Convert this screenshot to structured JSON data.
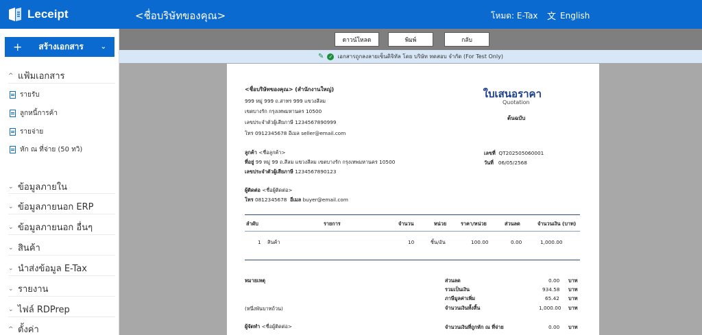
{
  "header": {
    "logo_text": "Leceipt",
    "company_title": "<ชื่อบริษัทของคุณ>",
    "mode_label": "โหมด: E-Tax",
    "language": "English",
    "brand_color": "#0b6ad0"
  },
  "sidebar": {
    "create_button": "สร้างเอกสาร",
    "documents_section": "แฟ้มเอกสาร",
    "documents_items": [
      "รายรับ",
      "ลูกหนี้การค้า",
      "รายจ่าย",
      "หัก ณ ที่จ่าย (50 ทวิ)"
    ],
    "sections": [
      "ข้อมูลภายใน",
      "ข้อมูลภายนอก ERP",
      "ข้อมูลภายนอก อื่นๆ",
      "สินค้า",
      "นำส่งข้อมูล E-Tax",
      "รายงาน",
      "ไฟล์ RDPrep",
      "ตั้งค่า"
    ]
  },
  "toolbar": {
    "download": "ดาวน์โหลด",
    "print": "พิมพ์",
    "back": "กลับ"
  },
  "signature_notice": "เอกสารถูกลงลายเซ็นดิจิทัล โดย บริษัท ทดสอบ จำกัด (For Test Only)",
  "document": {
    "seller_name": "<ชื่อบริษัทของคุณ> (สำนักงานใหญ่)",
    "seller_address1": "999 หมู่ 999 ถ.สาทร 999 แขวงสีลม",
    "seller_address2": "เขตบางรัก กรุงเทพมหานคร 10500",
    "seller_taxid_label": "เลขประจำตัวผู้เสียภาษี",
    "seller_taxid": "1234567890999",
    "seller_contact": "โทร 0912345678  อีเมล seller@email.com",
    "title": "ใบเสนอราคา",
    "title_en": "Quotation",
    "original": "ต้นฉบับ",
    "customer_label": "ลูกค้า",
    "customer_name": "<ชื่อลูกค้า>",
    "address_label": "ที่อยู่",
    "customer_address": "99 หมู่ 99 ถ.สีลม แขวงสีลม เขตบางรัก กรุงเทพมหานคร 10500",
    "customer_taxid_label": "เลขประจำตัวผู้เสียภาษี",
    "customer_taxid": "1234567890123",
    "number_label": "เลขที่",
    "number": "QT202505060001",
    "date_label": "วันที่",
    "date": "06/05/2568",
    "contact_label": "ผู้ติดต่อ",
    "contact_name": "<ชื่อผู้ติดต่อ>",
    "phone_label": "โทร",
    "phone": "0812345678",
    "email_label": "อีเมล",
    "email": "buyer@email.com",
    "columns": [
      "ลำดับ",
      "รายการ",
      "จำนวน",
      "หน่วย",
      "ราคา/หน่วย",
      "ส่วนลด",
      "จำนวนเงิน (บาท)"
    ],
    "rows": [
      {
        "no": "1",
        "item": "สินค้า",
        "qty": "10",
        "unit": "ชิ้น/อัน",
        "price": "100.00",
        "discount": "0.00",
        "amount": "1,000.00"
      }
    ],
    "note_label": "หมายเหตุ",
    "amount_text": "(หนึ่งพันบาทถ้วน)",
    "prepared_label": "ผู้จัดทำ",
    "prepared_name": "<ชื่อผู้ติดต่อ>",
    "summary": [
      {
        "label": "ส่วนลด",
        "value": "0.00",
        "unit": "บาท"
      },
      {
        "label": "รวมเป็นเงิน",
        "value": "934.58",
        "unit": "บาท"
      },
      {
        "label": "ภาษีมูลค่าเพิ่ม",
        "value": "65.42",
        "unit": "บาท"
      },
      {
        "label": "จำนวนเงินทั้งสิ้น",
        "value": "1,000.00",
        "unit": "บาท"
      },
      {
        "label": "จำนวนเงินที่ถูกหัก ณ ที่จ่าย",
        "value": "0.00",
        "unit": "บาท"
      }
    ]
  }
}
